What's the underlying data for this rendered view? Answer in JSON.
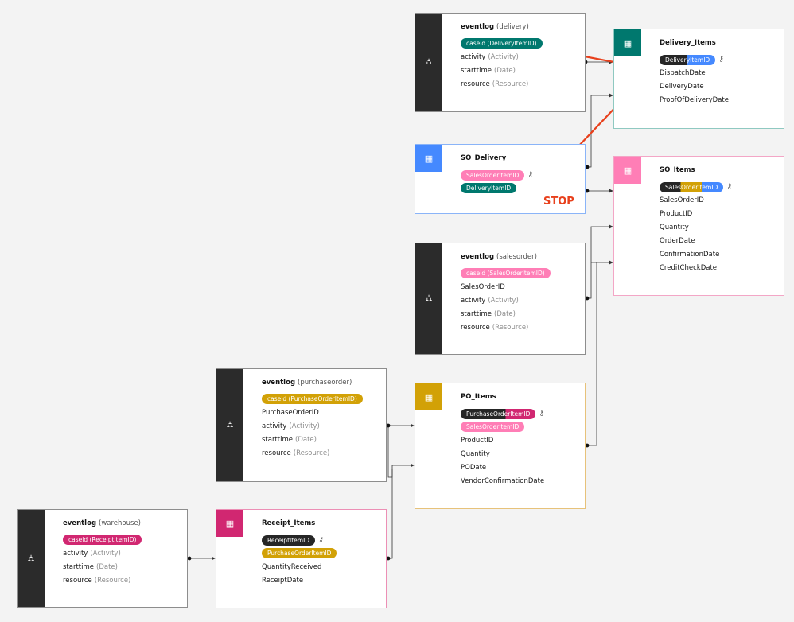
{
  "eventlog_delivery": {
    "title": "eventlog",
    "sub": "(delivery)",
    "case": "caseid  (DeliveryItemID)",
    "rows": [
      {
        "name": "activity",
        "type": "(Activity)"
      },
      {
        "name": "starttime",
        "type": "(Date)"
      },
      {
        "name": "resource",
        "type": "(Resource)"
      }
    ]
  },
  "delivery_items": {
    "title": "Delivery_Items",
    "key": "DeliveryItemID",
    "rows": [
      "DispatchDate",
      "DeliveryDate",
      "ProofOfDeliveryDate"
    ]
  },
  "so_delivery": {
    "title": "SO_Delivery",
    "pill1": "SalesOrderItemID",
    "pill2": "DeliveryItemID"
  },
  "so_items": {
    "title": "SO_Items",
    "key": "SalesOrderItemID",
    "rows": [
      "SalesOrderID",
      "ProductID",
      "Quantity",
      "OrderDate",
      "ConfirmationDate",
      "CreditCheckDate"
    ]
  },
  "eventlog_salesorder": {
    "title": "eventlog",
    "sub": "(salesorder)",
    "case": "caseid  (SalesOrderItemID)",
    "rows": [
      {
        "name": "SalesOrderID",
        "type": ""
      },
      {
        "name": "activity",
        "type": "(Activity)"
      },
      {
        "name": "starttime",
        "type": "(Date)"
      },
      {
        "name": "resource",
        "type": "(Resource)"
      }
    ]
  },
  "eventlog_purchaseorder": {
    "title": "eventlog",
    "sub": "(purchaseorder)",
    "case": "caseid  (PurchaseOrderItemID)",
    "rows": [
      {
        "name": "PurchaseOrderID",
        "type": ""
      },
      {
        "name": "activity",
        "type": "(Activity)"
      },
      {
        "name": "starttime",
        "type": "(Date)"
      },
      {
        "name": "resource",
        "type": "(Resource)"
      }
    ]
  },
  "po_items": {
    "title": "PO_Items",
    "key": "PurchaseOrderItemID",
    "pill2": "SalesOrderItemID",
    "rows": [
      "ProductID",
      "Quantity",
      "PODate",
      "VendorConfirmationDate"
    ]
  },
  "eventlog_warehouse": {
    "title": "eventlog",
    "sub": "(warehouse)",
    "case": "caseid  (ReceiptItemID)",
    "rows": [
      {
        "name": "activity",
        "type": "(Activity)"
      },
      {
        "name": "starttime",
        "type": "(Date)"
      },
      {
        "name": "resource",
        "type": "(Resource)"
      }
    ]
  },
  "receipt_items": {
    "title": "Receipt_Items",
    "key": "ReceiptItemID",
    "pill2": "PurchaseOrderItemID",
    "rows": [
      "QuantityReceived",
      "ReceiptDate"
    ]
  },
  "annotation": {
    "stop": "STOP"
  },
  "icons": {
    "eventlog": "eventlog-icon",
    "table": "table-icon",
    "key": "key-icon"
  },
  "colors": {
    "teal": "#00786e",
    "blue": "#4589ff",
    "pink": "#ff7eb6",
    "magenta": "#d12771",
    "gold": "#d2a106",
    "dark": "#262626",
    "red": "#e8401c"
  }
}
